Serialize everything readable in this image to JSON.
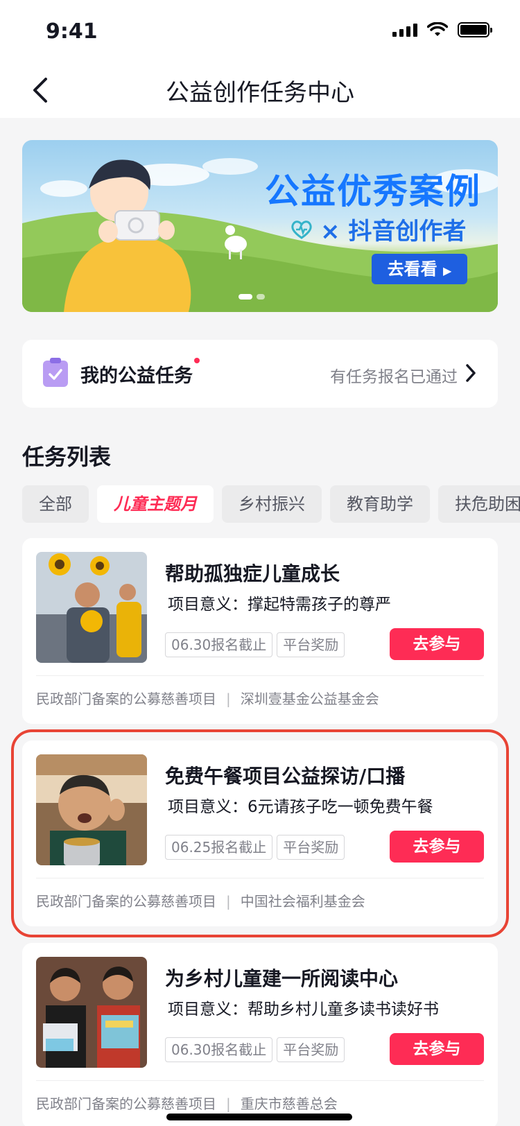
{
  "status": {
    "time": "9:41"
  },
  "nav": {
    "title": "公益创作任务中心"
  },
  "banner": {
    "title": "公益优秀案例",
    "subtitle": "× 抖音创作者",
    "button": "去看看"
  },
  "my_task": {
    "label": "我的公益任务",
    "status": "有任务报名已通过"
  },
  "section": {
    "title": "任务列表"
  },
  "tabs": [
    {
      "label": "全部"
    },
    {
      "label": "儿童主题月"
    },
    {
      "label": "乡村振兴"
    },
    {
      "label": "教育助学"
    },
    {
      "label": "扶危助困"
    }
  ],
  "tasks": [
    {
      "title": "帮助孤独症儿童成长",
      "meaning": "项目意义：撑起特需孩子的尊严",
      "deadline": "06.30报名截止",
      "reward": "平台奖励",
      "button": "去参与",
      "footer_left": "民政部门备案的公募慈善项目",
      "separator": "|",
      "footer_right": "深圳壹基金公益基金会"
    },
    {
      "title": "免费午餐项目公益探访/口播",
      "meaning": "项目意义：6元请孩子吃一顿免费午餐",
      "deadline": "06.25报名截止",
      "reward": "平台奖励",
      "button": "去参与",
      "footer_left": "民政部门备案的公募慈善项目",
      "separator": "|",
      "footer_right": "中国社会福利基金会"
    },
    {
      "title": "为乡村儿童建一所阅读中心",
      "meaning": "项目意义：帮助乡村儿童多读书读好书",
      "deadline": "06.30报名截止",
      "reward": "平台奖励",
      "button": "去参与",
      "footer_left": "民政部门备案的公募慈善项目",
      "separator": "|",
      "footer_right": "重庆市慈善总会"
    }
  ],
  "colors": {
    "accent": "#fe2c55",
    "banner_blue": "#1677ff",
    "highlight": "#e84435"
  }
}
